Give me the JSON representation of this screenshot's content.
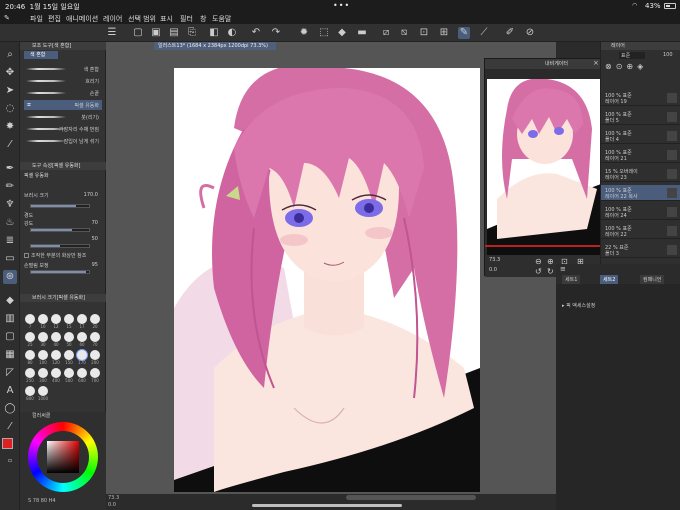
{
  "status": {
    "time": "20:46",
    "date": "1월 15일 일요일",
    "battery": "43%"
  },
  "menu": [
    "파일",
    "편집",
    "애니메이션",
    "레이어",
    "선택 범위",
    "표시",
    "필터",
    "창",
    "도움말"
  ],
  "subtool_panel": {
    "title": "보조 도구[색 혼합]",
    "group": "색 혼합",
    "brushes": [
      {
        "label": "색 혼합"
      },
      {
        "label": "흐리기"
      },
      {
        "label": "손끝"
      },
      {
        "label": "픽셀 유동화"
      },
      {
        "label": "붓(리기)"
      },
      {
        "label": "가장자리 수채 번짐"
      },
      {
        "label": "잠입이 남게 섞기"
      }
    ],
    "selected_index": 3
  },
  "tool_property": {
    "title": "도구 속성[픽셀 유동화]",
    "name": "픽셀 유동화",
    "rows": [
      {
        "label": "브러시 크기",
        "value": "170.0"
      },
      {
        "label": "경도",
        "value": ""
      },
      {
        "label": "강도",
        "value": "70"
      },
      {
        "label": "",
        "value": "50"
      },
      {
        "label": "조작한 부분의 화상만 참조",
        "value": ""
      },
      {
        "label": "손떨림 보정",
        "value": "95"
      }
    ],
    "levels": {
      "brush_size": 0.78,
      "strength": 0.7,
      "fifty": 0.5,
      "stabilizer": 0.95
    }
  },
  "brush_size_panel": {
    "title": "브러시 크기[픽셀 유동화]",
    "sizes": [
      "7",
      "10",
      "12",
      "15",
      "17",
      "20",
      "25",
      "30",
      "40",
      "50",
      "60",
      "70",
      "80",
      "100",
      "120",
      "150",
      "170",
      "200",
      "250",
      "300",
      "400",
      "500",
      "600",
      "700",
      "800",
      "1000"
    ],
    "selected": "170"
  },
  "color_panel": {
    "title": "컬러써클",
    "main_color": "#e02020",
    "sub_color": "#ffffff",
    "readout": "S  78  80  H4"
  },
  "document": {
    "tab": "일러스트13* (1684 x 2384px 1200dpi 73.3%)",
    "zoom": "73.3",
    "rotation": "0.0"
  },
  "navigator": {
    "title": "내비게이터",
    "zoom": "73.3",
    "rotation": "0.0"
  },
  "layer_panel": {
    "title": "레이어",
    "blend": "표준",
    "opacity": "100",
    "layers": [
      {
        "l1": "100 % 표준",
        "l2": "레이어 19"
      },
      {
        "l1": "100 % 표준",
        "l2": "폴더 5"
      },
      {
        "l1": "100 % 표준",
        "l2": "폴더 4"
      },
      {
        "l1": "100 % 표준",
        "l2": "레이어 21"
      },
      {
        "l1": "15 % 오버레이",
        "l2": "레이어 23"
      },
      {
        "l1": "100 % 표준",
        "l2": "레이어 22 복사"
      },
      {
        "l1": "100 % 표준",
        "l2": "레이어 24"
      },
      {
        "l1": "100 % 표준",
        "l2": "레이어 22"
      },
      {
        "l1": "22 % 표준",
        "l2": "폴더 3"
      }
    ],
    "selected_index": 5
  },
  "sub_panel": {
    "tabs": [
      "세트1",
      "세트2",
      "컴패니언"
    ],
    "selected_index": 1,
    "row": "▸ 픽 액세스설정"
  }
}
